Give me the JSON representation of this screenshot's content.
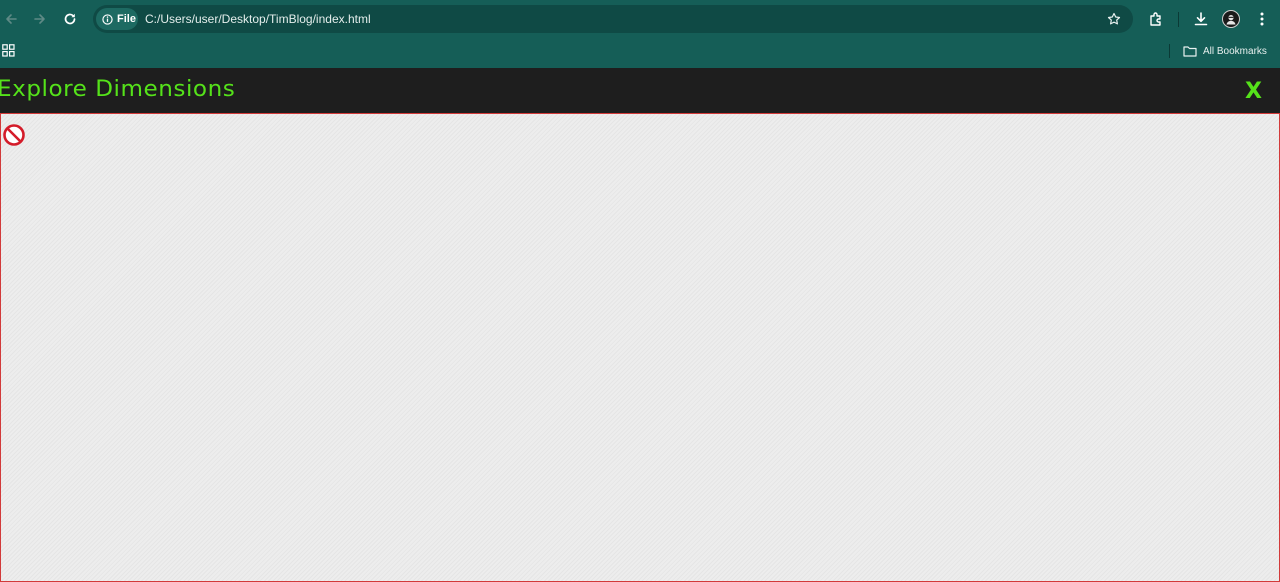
{
  "browser": {
    "site_chip_label": "File",
    "url": "C:/Users/user/Desktop/TimBlog/index.html",
    "bookmarks_label": "All Bookmarks"
  },
  "page": {
    "title": "Explore Dimensions",
    "close_label": "X"
  },
  "icons": {
    "back": "back-arrow-icon",
    "forward": "forward-arrow-icon",
    "reload": "reload-icon",
    "info": "info-icon",
    "star": "bookmark-star-icon",
    "extensions": "extensions-puzzle-icon",
    "download": "download-icon",
    "avatar": "profile-avatar-icon",
    "menu": "kebab-menu-icon",
    "apps": "apps-grid-icon",
    "folder": "folder-icon",
    "blocked": "no-entry-icon"
  },
  "colors": {
    "chrome": "#155e57",
    "omnibox": "#0f4a45",
    "header": "#1e1e1e",
    "accent_green": "#55e21a",
    "content_border": "#d23a3a",
    "no_entry_red": "#d41c2a"
  }
}
